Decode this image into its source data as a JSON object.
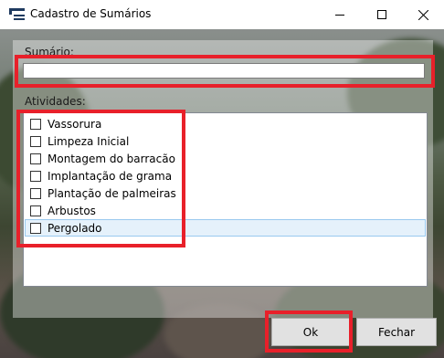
{
  "window": {
    "title": "Cadastro de Sumários",
    "icon": "app-form-icon",
    "controls": [
      "minimize-icon",
      "maximize-icon",
      "close-icon"
    ]
  },
  "form": {
    "summary_label": "Sumário:",
    "summary_value": "",
    "activities_label": "Atividades:",
    "activities": [
      {
        "label": "Vassorura",
        "checked": false
      },
      {
        "label": "Limpeza Inicial",
        "checked": false
      },
      {
        "label": "Montagem do barracão",
        "checked": false
      },
      {
        "label": "Implantação de grama",
        "checked": false
      },
      {
        "label": "Plantação de palmeiras",
        "checked": false
      },
      {
        "label": "Arbustos",
        "checked": false
      },
      {
        "label": "Pergolado",
        "checked": false,
        "selected": true
      }
    ]
  },
  "buttons": {
    "ok_label": "Ok",
    "close_label": "Fechar"
  },
  "colors": {
    "highlight": "#e8202a",
    "selection_bg": "#e5f1fb",
    "selection_border": "#99c9ef"
  }
}
